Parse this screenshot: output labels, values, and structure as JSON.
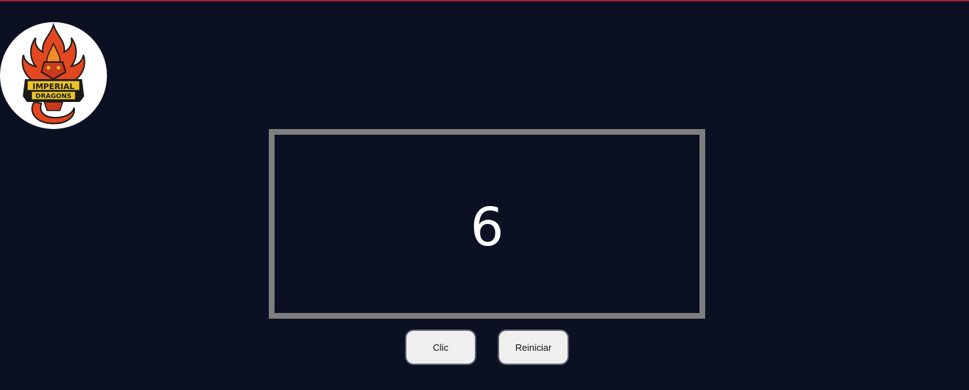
{
  "logo": {
    "text_line1": "IMPERIAL",
    "text_line2": "DRAGONS",
    "colors": {
      "flame": "#e2471f",
      "gold": "#e8c32a",
      "dark": "#1a1a1a"
    }
  },
  "counter": {
    "value": "6",
    "border_color": "#7f7f7f"
  },
  "buttons": {
    "click_label": "Clic",
    "reset_label": "Reiniciar"
  },
  "theme": {
    "background": "#0b1023",
    "accent_line": "#9b2335"
  }
}
